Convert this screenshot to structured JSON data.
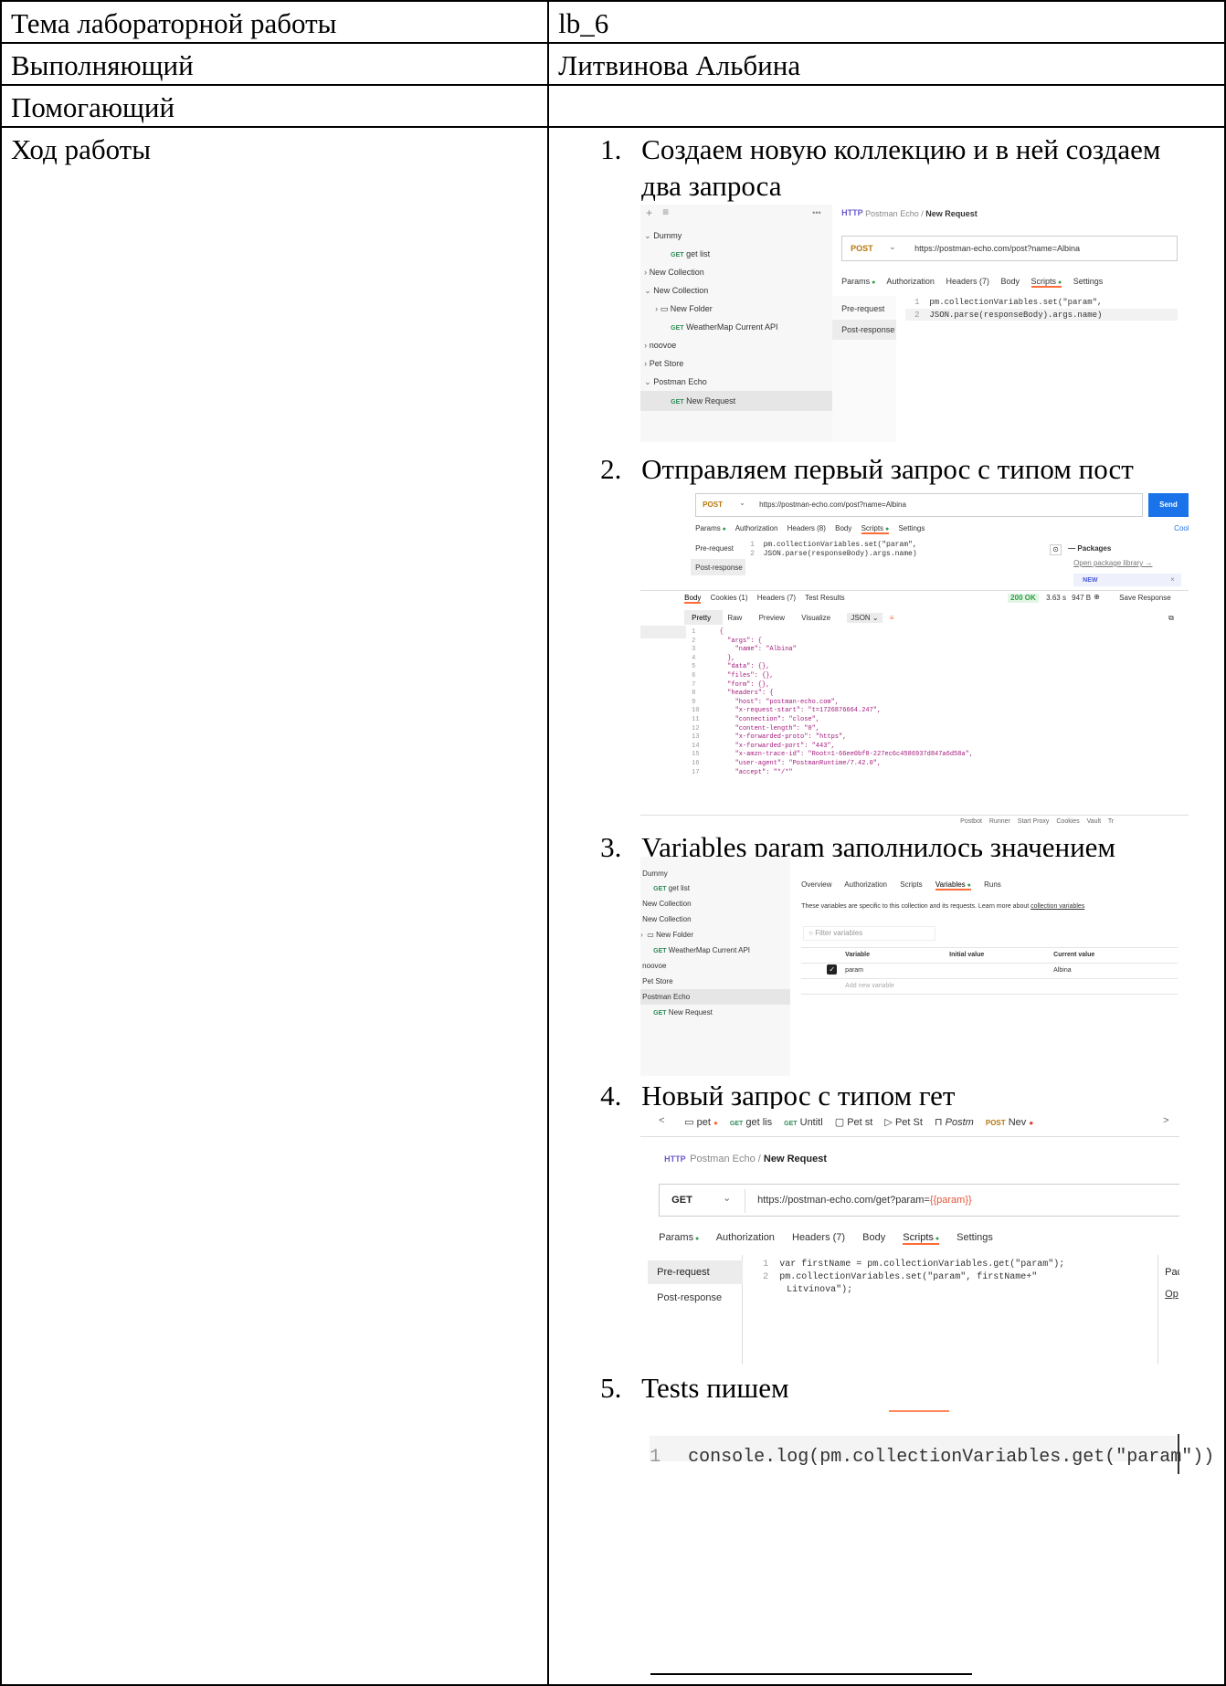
{
  "rows": [
    {
      "label": "Тема лабораторной работы",
      "value": "lb_6"
    },
    {
      "label": "Выполняющий",
      "value": "Литвинова Альбина"
    },
    {
      "label": "Помогающий",
      "value": ""
    },
    {
      "label": "Ход работы"
    }
  ],
  "steps": [
    {
      "num": "1.",
      "text": "Создаем новую коллекцию и в ней создаем два запроса"
    },
    {
      "num": "2.",
      "text": "Отправляем первый запрос с типом пост"
    },
    {
      "num": "3.",
      "text": "Variables param заполнилось значением"
    },
    {
      "num": "4.",
      "text": "Новый запрос с типом гет"
    },
    {
      "num": "5.",
      "text": "Tests пишем"
    }
  ],
  "shot1": {
    "tree": [
      {
        "label": "Dummy",
        "kind": "open"
      },
      {
        "label": "get list",
        "method": "GET"
      },
      {
        "label": "New Collection",
        "kind": "closed"
      },
      {
        "label": "New Collection",
        "kind": "open"
      },
      {
        "label": "New Folder",
        "kind": "folder"
      },
      {
        "label": "WeatherMap Current API",
        "method": "GET"
      },
      {
        "label": "noovoe",
        "kind": "closed"
      },
      {
        "label": "Pet Store",
        "kind": "closed"
      },
      {
        "label": "Postman Echo",
        "kind": "open"
      },
      {
        "label": "New Request",
        "method": "GET"
      }
    ],
    "breadcrumb_parent": "Postman Echo",
    "breadcrumb_sep": "/",
    "breadcrumb_current": "New Request",
    "method": "POST",
    "url": "https://postman-echo.com/post?name=Albina",
    "tabs": [
      "Params",
      "Authorization",
      "Headers (7)",
      "Body",
      "Scripts",
      "Settings"
    ],
    "side_tabs": [
      "Pre-request",
      "Post-response"
    ],
    "code": [
      {
        "n": "1",
        "text": "pm.collectionVariables.set(\"param\","
      },
      {
        "n": "2",
        "text": "JSON.parse(responseBody).args.name)"
      }
    ],
    "more": "•••",
    "plus": "+",
    "filter": "≡"
  },
  "shot2": {
    "method": "POST",
    "url": "https://postman-echo.com/post?name=Albina",
    "send": "Send",
    "cookies": "Cook",
    "tabs": [
      "Params",
      "Authorization",
      "Headers (8)",
      "Body",
      "Scripts",
      "Settings"
    ],
    "side_tabs": [
      "Pre-request",
      "Post-response"
    ],
    "code": [
      {
        "n": "1",
        "text": "pm.collectionVariables.set(\"param\","
      },
      {
        "n": "2",
        "text": "JSON.parse(responseBody).args.name)"
      }
    ],
    "packages": "Packages",
    "open_pkg": "Open package library →",
    "new_badge": "NEW",
    "close_x": "×",
    "resp_tabs": [
      "Body",
      "Cookies (1)",
      "Headers (7)",
      "Test Results"
    ],
    "status": "200 OK",
    "time": "3.63 s",
    "size": "947 B",
    "save_resp": "Save Response",
    "view_tabs": [
      "Pretty",
      "Raw",
      "Preview",
      "Visualize",
      "JSON"
    ],
    "json": [
      {
        "n": "1",
        "text": "{"
      },
      {
        "n": "2",
        "text": "  \"args\": {"
      },
      {
        "n": "3",
        "text": "    \"name\": \"Albina\""
      },
      {
        "n": "4",
        "text": "  },"
      },
      {
        "n": "5",
        "text": "  \"data\": {},"
      },
      {
        "n": "6",
        "text": "  \"files\": {},"
      },
      {
        "n": "7",
        "text": "  \"form\": {},"
      },
      {
        "n": "8",
        "text": "  \"headers\": {"
      },
      {
        "n": "9",
        "text": "    \"host\": \"postman-echo.com\","
      },
      {
        "n": "10",
        "text": "    \"x-request-start\": \"t=1726876664.247\","
      },
      {
        "n": "11",
        "text": "    \"connection\": \"close\","
      },
      {
        "n": "12",
        "text": "    \"content-length\": \"0\","
      },
      {
        "n": "13",
        "text": "    \"x-forwarded-proto\": \"https\","
      },
      {
        "n": "14",
        "text": "    \"x-forwarded-port\": \"443\","
      },
      {
        "n": "15",
        "text": "    \"x-amzn-trace-id\": \"Root=1-66ee0bf8-227ec6c4586937d847a6d58a\","
      },
      {
        "n": "16",
        "text": "    \"user-agent\": \"PostmanRuntime/7.42.0\","
      },
      {
        "n": "17",
        "text": "    \"accept\": \"*/*\""
      }
    ],
    "status_bar": [
      "Postbot",
      "Runner",
      "Start Proxy",
      "Cookies",
      "Vault",
      "Tr"
    ]
  },
  "shot3": {
    "tree": [
      {
        "label": "Dummy"
      },
      {
        "label": "get list",
        "method": "GET"
      },
      {
        "label": "New Collection"
      },
      {
        "label": "New Collection"
      },
      {
        "label": "New Folder",
        "kind": "folder"
      },
      {
        "label": "WeatherMap Current API",
        "method": "GET"
      },
      {
        "label": "noovoe"
      },
      {
        "label": "Pet Store"
      },
      {
        "label": "Postman Echo",
        "selected": true
      },
      {
        "label": "New Request",
        "method": "GET"
      }
    ],
    "tabs": [
      "Overview",
      "Authorization",
      "Scripts",
      "Variables",
      "Runs"
    ],
    "desc": "These variables are specific to this collection and its requests. Learn more about",
    "desc_link": "collection variables",
    "filter": "Filter variables",
    "columns": [
      "Variable",
      "Initial value",
      "Current value"
    ],
    "row": {
      "name": "param",
      "initial": "",
      "current": "Albina"
    },
    "add_new": "Add new variable"
  },
  "shot4": {
    "tabs": [
      {
        "method": "",
        "label": "pet"
      },
      {
        "method": "GET",
        "label": "get lis"
      },
      {
        "method": "GET",
        "label": "Untitl"
      },
      {
        "method": "",
        "label": "Pet st"
      },
      {
        "method": "",
        "label": "Pet St"
      },
      {
        "method": "",
        "label": "Postm"
      },
      {
        "method": "POST",
        "label": "Nev"
      }
    ],
    "nav_left": "<",
    "nav_right": ">",
    "plus": "+",
    "breadcrumb_parent": "Postman Echo",
    "breadcrumb_sep": "/",
    "breadcrumb_current": "New Request",
    "method": "GET",
    "url_base": "https://postman-echo.com/get?param=",
    "url_var": "{{param}}",
    "tabs2": [
      "Params",
      "Authorization",
      "Headers (7)",
      "Body",
      "Scripts",
      "Settings"
    ],
    "side_tabs": [
      "Pre-request",
      "Post-response"
    ],
    "code": [
      {
        "n": "1",
        "text": "var firstName = pm.collectionVariables.get(\"param\");"
      },
      {
        "n": "2",
        "text": "pm.collectionVariables.set(\"param\", firstName+\""
      },
      {
        "n": "",
        "text": "    Litvinova\");"
      }
    ],
    "cut_text": "Pac",
    "cut_link": "Op"
  },
  "shot5": {
    "n": "1",
    "code": "console.log(pm.collectionVariables.get(\"param\"))"
  }
}
